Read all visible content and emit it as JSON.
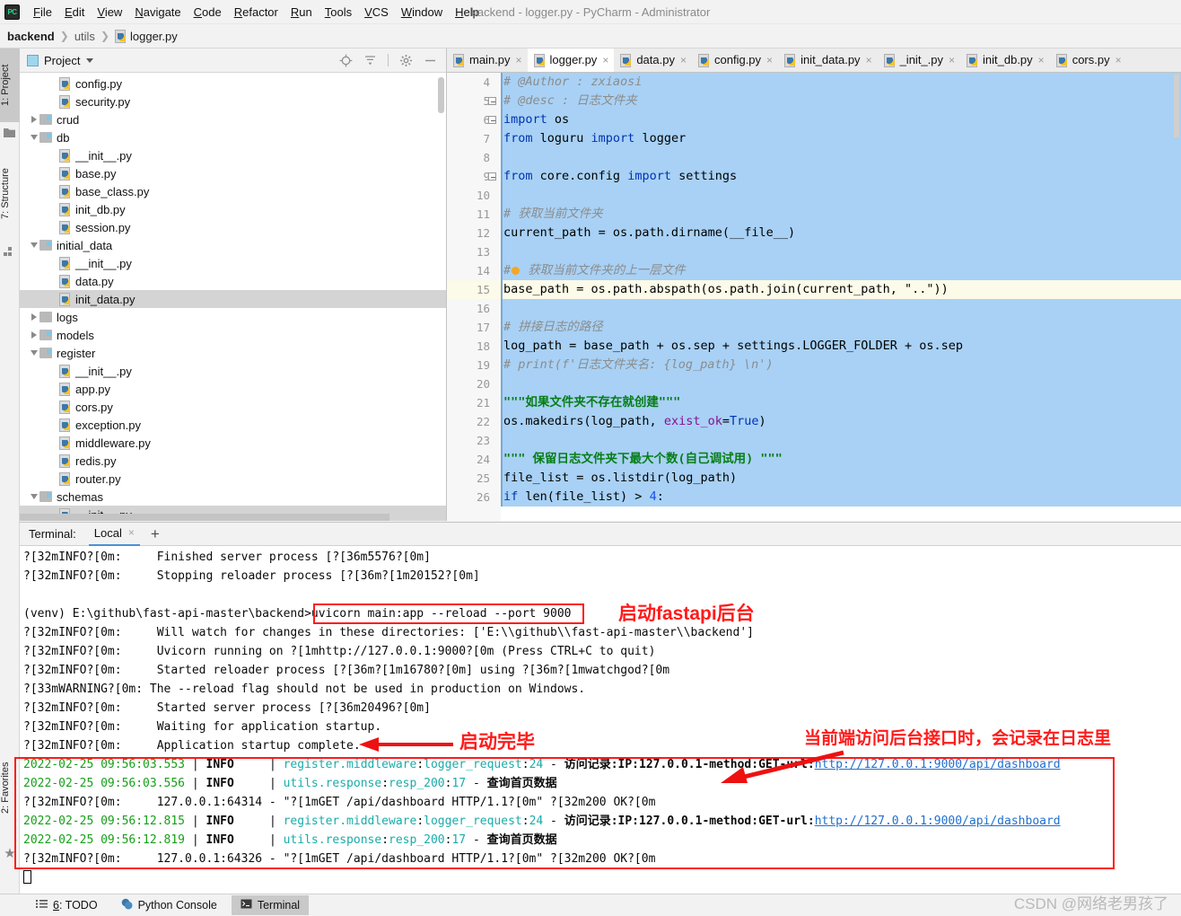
{
  "window": {
    "title": "backend - logger.py - PyCharm - Administrator",
    "logo_text": "PC"
  },
  "menubar": {
    "items": [
      "File",
      "Edit",
      "View",
      "Navigate",
      "Code",
      "Refactor",
      "Run",
      "Tools",
      "VCS",
      "Window",
      "Help"
    ]
  },
  "breadcrumb": {
    "items": [
      "backend",
      "utils",
      "logger.py"
    ]
  },
  "left_tool_strip": {
    "project_label": "1: Project",
    "structure_label": "7: Structure",
    "favorites_label": "2: Favorites"
  },
  "project_panel": {
    "title": "Project",
    "icons": [
      "locate-icon",
      "collapse-all-icon",
      "gear-icon",
      "minimize-icon"
    ],
    "tree": [
      {
        "label": "config.py",
        "type": "file",
        "indent": 3,
        "arrow": "none",
        "selected": false
      },
      {
        "label": "security.py",
        "type": "file",
        "indent": 3,
        "arrow": "none",
        "selected": false
      },
      {
        "label": "crud",
        "type": "folder",
        "indent": 2,
        "arrow": "right",
        "selected": false,
        "source": true
      },
      {
        "label": "db",
        "type": "folder",
        "indent": 2,
        "arrow": "down",
        "selected": false,
        "source": true
      },
      {
        "label": "__init__.py",
        "type": "file",
        "indent": 3,
        "arrow": "none",
        "selected": false
      },
      {
        "label": "base.py",
        "type": "file",
        "indent": 3,
        "arrow": "none",
        "selected": false
      },
      {
        "label": "base_class.py",
        "type": "file",
        "indent": 3,
        "arrow": "none",
        "selected": false
      },
      {
        "label": "init_db.py",
        "type": "file",
        "indent": 3,
        "arrow": "none",
        "selected": false
      },
      {
        "label": "session.py",
        "type": "file",
        "indent": 3,
        "arrow": "none",
        "selected": false
      },
      {
        "label": "initial_data",
        "type": "folder",
        "indent": 2,
        "arrow": "down",
        "selected": false,
        "source": true
      },
      {
        "label": "__init__.py",
        "type": "file",
        "indent": 3,
        "arrow": "none",
        "selected": false
      },
      {
        "label": "data.py",
        "type": "file",
        "indent": 3,
        "arrow": "none",
        "selected": false
      },
      {
        "label": "init_data.py",
        "type": "file",
        "indent": 3,
        "arrow": "none",
        "selected": true
      },
      {
        "label": "logs",
        "type": "folder",
        "indent": 2,
        "arrow": "right",
        "selected": false,
        "source": false
      },
      {
        "label": "models",
        "type": "folder",
        "indent": 2,
        "arrow": "right",
        "selected": false,
        "source": true
      },
      {
        "label": "register",
        "type": "folder",
        "indent": 2,
        "arrow": "down",
        "selected": false,
        "source": true
      },
      {
        "label": "__init__.py",
        "type": "file",
        "indent": 3,
        "arrow": "none",
        "selected": false
      },
      {
        "label": "app.py",
        "type": "file",
        "indent": 3,
        "arrow": "none",
        "selected": false
      },
      {
        "label": "cors.py",
        "type": "file",
        "indent": 3,
        "arrow": "none",
        "selected": false
      },
      {
        "label": "exception.py",
        "type": "file",
        "indent": 3,
        "arrow": "none",
        "selected": false
      },
      {
        "label": "middleware.py",
        "type": "file",
        "indent": 3,
        "arrow": "none",
        "selected": false
      },
      {
        "label": "redis.py",
        "type": "file",
        "indent": 3,
        "arrow": "none",
        "selected": false
      },
      {
        "label": "router.py",
        "type": "file",
        "indent": 3,
        "arrow": "none",
        "selected": false
      },
      {
        "label": "schemas",
        "type": "folder",
        "indent": 2,
        "arrow": "down",
        "selected": false,
        "source": true
      },
      {
        "label": "__init__.py",
        "type": "file",
        "indent": 3,
        "arrow": "none",
        "selected": true
      }
    ]
  },
  "editor_tabs": [
    {
      "label": "main.py",
      "active": false
    },
    {
      "label": "logger.py",
      "active": true
    },
    {
      "label": "data.py",
      "active": false
    },
    {
      "label": "config.py",
      "active": false
    },
    {
      "label": "init_data.py",
      "active": false
    },
    {
      "label": "_init_.py",
      "active": false
    },
    {
      "label": "init_db.py",
      "active": false
    },
    {
      "label": "cors.py",
      "active": false
    }
  ],
  "editor": {
    "first_line_number": 4,
    "lines": [
      {
        "n": 4,
        "text": "# @Author : zxiaosi",
        "kind": "comment",
        "selected": true,
        "partial": true
      },
      {
        "n": 5,
        "text": "# @desc : 日志文件夹",
        "kind": "comment",
        "selected": true,
        "fold": true
      },
      {
        "n": 6,
        "text": "import os",
        "kind": "import",
        "selected": true,
        "fold": true
      },
      {
        "n": 7,
        "text": "from loguru import logger",
        "kind": "import2",
        "selected": true
      },
      {
        "n": 8,
        "text": "",
        "kind": "blank",
        "selected": true
      },
      {
        "n": 9,
        "text": "from core.config import settings",
        "kind": "import3",
        "selected": true,
        "fold": true
      },
      {
        "n": 10,
        "text": "",
        "kind": "blank",
        "selected": true
      },
      {
        "n": 11,
        "text": "# 获取当前文件夹",
        "kind": "comment",
        "selected": true
      },
      {
        "n": 12,
        "text": "current_path = os.path.dirname(__file__)",
        "kind": "code1",
        "selected": true
      },
      {
        "n": 13,
        "text": "",
        "kind": "blank",
        "selected": true
      },
      {
        "n": 14,
        "text": "# 获取当前文件夹的上一层文件",
        "kind": "comment_bulb",
        "selected": true
      },
      {
        "n": 15,
        "text": "base_path = os.path.abspath(os.path.join(current_path, \"..\"))",
        "kind": "code2",
        "selected": true,
        "current": true
      },
      {
        "n": 16,
        "text": "",
        "kind": "blank",
        "selected": true
      },
      {
        "n": 17,
        "text": "# 拼接日志的路径",
        "kind": "comment",
        "selected": true
      },
      {
        "n": 18,
        "text": "log_path = base_path + os.sep + settings.LOGGER_FOLDER + os.sep",
        "kind": "code3",
        "selected": true
      },
      {
        "n": 19,
        "text": "# print(f'日志文件夹名: {log_path} \\n')",
        "kind": "comment",
        "selected": true
      },
      {
        "n": 20,
        "text": "",
        "kind": "blank",
        "selected": true
      },
      {
        "n": 21,
        "text": "\"\"\"如果文件夹不存在就创建\"\"\"",
        "kind": "docstring",
        "selected": true
      },
      {
        "n": 22,
        "text": "os.makedirs(log_path, exist_ok=True)",
        "kind": "code4",
        "selected": true
      },
      {
        "n": 23,
        "text": "",
        "kind": "blank",
        "selected": true
      },
      {
        "n": 24,
        "text": "\"\"\" 保留日志文件夹下最大个数(自己调试用) \"\"\"",
        "kind": "docstring",
        "selected": true
      },
      {
        "n": 25,
        "text": "file_list = os.listdir(log_path)",
        "kind": "code5",
        "selected": true
      },
      {
        "n": 26,
        "text": "if len(file_list) > 4:",
        "kind": "code6",
        "selected": true
      }
    ]
  },
  "terminal_header": {
    "label": "Terminal:",
    "tab": "Local",
    "close": "×",
    "plus": "+"
  },
  "terminal": {
    "lines": [
      {
        "id": 1,
        "segments": [
          {
            "t": "?[32mINFO?[0m:     Finished server process [?[36m5576?[0m]",
            "c": "black"
          }
        ]
      },
      {
        "id": 2,
        "segments": [
          {
            "t": "?[32mINFO?[0m:     Stopping reloader process [?[36m?[1m20152?[0m]",
            "c": "black"
          }
        ]
      },
      {
        "id": 3,
        "segments": [
          {
            "t": "",
            "c": "black"
          }
        ]
      },
      {
        "id": 4,
        "segments": [
          {
            "t": "(venv) E:\\github\\fast-api-master\\backend>uvicorn main:app --reload --port 9000",
            "c": "black"
          }
        ]
      },
      {
        "id": 5,
        "segments": [
          {
            "t": "?[32mINFO?[0m:     Will watch for changes in these directories: ['E:\\\\github\\\\fast-api-master\\\\backend']",
            "c": "black"
          }
        ]
      },
      {
        "id": 6,
        "segments": [
          {
            "t": "?[32mINFO?[0m:     Uvicorn running on ?[1mhttp://127.0.0.1:9000?[0m (Press CTRL+C to quit)",
            "c": "black"
          }
        ]
      },
      {
        "id": 7,
        "segments": [
          {
            "t": "?[32mINFO?[0m:     Started reloader process [?[36m?[1m16780?[0m] using ?[36m?[1mwatchgod?[0m",
            "c": "black"
          }
        ]
      },
      {
        "id": 8,
        "segments": [
          {
            "t": "?[33mWARNING?[0m: The --reload flag should not be used in production on Windows.",
            "c": "black"
          }
        ]
      },
      {
        "id": 9,
        "segments": [
          {
            "t": "?[32mINFO?[0m:     Started server process [?[36m20496?[0m]",
            "c": "black"
          }
        ]
      },
      {
        "id": 10,
        "segments": [
          {
            "t": "?[32mINFO?[0m:     Waiting for application startup.",
            "c": "black"
          }
        ]
      },
      {
        "id": 11,
        "segments": [
          {
            "t": "?[32mINFO?[0m:     Application startup complete.",
            "c": "black"
          }
        ]
      },
      {
        "id": 12,
        "segments": [
          {
            "t": "2022-02-25 09:56:03.553",
            "c": "green"
          },
          {
            "t": " | ",
            "c": "black"
          },
          {
            "t": "INFO",
            "c": "bold"
          },
          {
            "t": "     | ",
            "c": "black"
          },
          {
            "t": "register.middleware",
            "c": "cyan"
          },
          {
            "t": ":",
            "c": "black"
          },
          {
            "t": "logger_request",
            "c": "cyan"
          },
          {
            "t": ":",
            "c": "black"
          },
          {
            "t": "24",
            "c": "cyan"
          },
          {
            "t": " - ",
            "c": "black"
          },
          {
            "t": "访问记录:IP:127.0.0.1-method:GET-url:",
            "c": "bold"
          },
          {
            "t": "http://127.0.0.1:9000/api/dashboard",
            "c": "link"
          }
        ]
      },
      {
        "id": 13,
        "segments": [
          {
            "t": "2022-02-25 09:56:03.556",
            "c": "green"
          },
          {
            "t": " | ",
            "c": "black"
          },
          {
            "t": "INFO",
            "c": "bold"
          },
          {
            "t": "     | ",
            "c": "black"
          },
          {
            "t": "utils.response",
            "c": "cyan"
          },
          {
            "t": ":",
            "c": "black"
          },
          {
            "t": "resp_200",
            "c": "cyan"
          },
          {
            "t": ":",
            "c": "black"
          },
          {
            "t": "17",
            "c": "cyan"
          },
          {
            "t": " - ",
            "c": "black"
          },
          {
            "t": "查询首页数据",
            "c": "bold"
          }
        ]
      },
      {
        "id": 14,
        "segments": [
          {
            "t": "?[32mINFO?[0m:     127.0.0.1:64314 - \"?[1mGET /api/dashboard HTTP/1.1?[0m\" ?[32m200 OK?[0m",
            "c": "black"
          }
        ]
      },
      {
        "id": 15,
        "segments": [
          {
            "t": "2022-02-25 09:56:12.815",
            "c": "green"
          },
          {
            "t": " | ",
            "c": "black"
          },
          {
            "t": "INFO",
            "c": "bold"
          },
          {
            "t": "     | ",
            "c": "black"
          },
          {
            "t": "register.middleware",
            "c": "cyan"
          },
          {
            "t": ":",
            "c": "black"
          },
          {
            "t": "logger_request",
            "c": "cyan"
          },
          {
            "t": ":",
            "c": "black"
          },
          {
            "t": "24",
            "c": "cyan"
          },
          {
            "t": " - ",
            "c": "black"
          },
          {
            "t": "访问记录:IP:127.0.0.1-method:GET-url:",
            "c": "bold"
          },
          {
            "t": "http://127.0.0.1:9000/api/dashboard",
            "c": "link"
          }
        ]
      },
      {
        "id": 16,
        "segments": [
          {
            "t": "2022-02-25 09:56:12.819",
            "c": "green"
          },
          {
            "t": " | ",
            "c": "black"
          },
          {
            "t": "INFO",
            "c": "bold"
          },
          {
            "t": "     | ",
            "c": "black"
          },
          {
            "t": "utils.response",
            "c": "cyan"
          },
          {
            "t": ":",
            "c": "black"
          },
          {
            "t": "resp_200",
            "c": "cyan"
          },
          {
            "t": ":",
            "c": "black"
          },
          {
            "t": "17",
            "c": "cyan"
          },
          {
            "t": " - ",
            "c": "black"
          },
          {
            "t": "查询首页数据",
            "c": "bold"
          }
        ]
      },
      {
        "id": 17,
        "segments": [
          {
            "t": "?[32mINFO?[0m:     127.0.0.1:64326 - \"?[1mGET /api/dashboard HTTP/1.1?[0m\" ?[32m200 OK?[0m",
            "c": "black"
          }
        ]
      }
    ]
  },
  "annotations": {
    "start_backend": "启动fastapi后台",
    "startup_done": "启动完毕",
    "log_note": "当前端访问后台接口时，会记录在日志里",
    "accent_red": "#ff1a1a"
  },
  "statusbar": {
    "items": [
      {
        "label": "6: TODO",
        "icon": "list-icon",
        "active": false
      },
      {
        "label": "Python Console",
        "icon": "python-icon",
        "active": false
      },
      {
        "label": "Terminal",
        "icon": "terminal-icon",
        "active": true
      }
    ],
    "watermark": "CSDN @网络老男孩了"
  }
}
